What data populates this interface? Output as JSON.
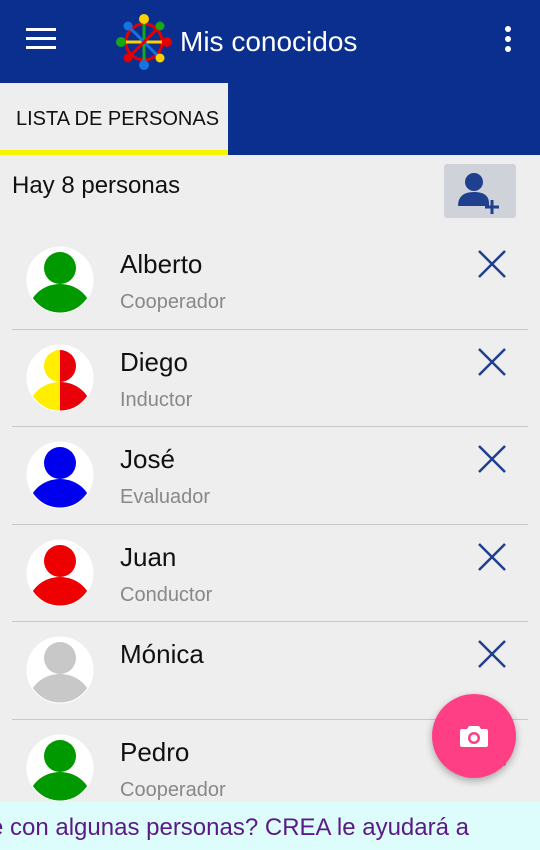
{
  "appbar": {
    "title": "Mis conocidos",
    "menu_icon": "hamburger-menu-icon",
    "overflow_icon": "more-vert-icon",
    "logo_icon": "people-circle-logo",
    "color": "#0b2f8f"
  },
  "tabs": [
    {
      "label": "LISTA DE PERSONAS",
      "selected": true
    }
  ],
  "list_header": {
    "count_text": "Hay 8 personas",
    "add_icon": "add-person-icon"
  },
  "people": [
    {
      "name": "Alberto",
      "role": "Cooperador",
      "avatar_colors": [
        "#009a00"
      ]
    },
    {
      "name": "Diego",
      "role": "Inductor",
      "avatar_colors": [
        "#ffee00",
        "#e8000b"
      ]
    },
    {
      "name": "José",
      "role": "Evaluador",
      "avatar_colors": [
        "#0000ee"
      ]
    },
    {
      "name": "Juan",
      "role": "Conductor",
      "avatar_colors": [
        "#ee0000"
      ]
    },
    {
      "name": "Mónica",
      "role": "",
      "avatar_colors": [
        "#c8c8c8"
      ]
    },
    {
      "name": "Pedro",
      "role": "Cooperador",
      "avatar_colors": [
        "#009a00"
      ]
    }
  ],
  "fab": {
    "icon": "camera-icon",
    "color": "#ff3f85"
  },
  "ticker": {
    "text": "e con algunas personas? CREA le ayudará a"
  },
  "colors": {
    "accent": "#f7f200",
    "icon_blue": "#1f3f8f",
    "ticker_text": "#5b1a86"
  }
}
